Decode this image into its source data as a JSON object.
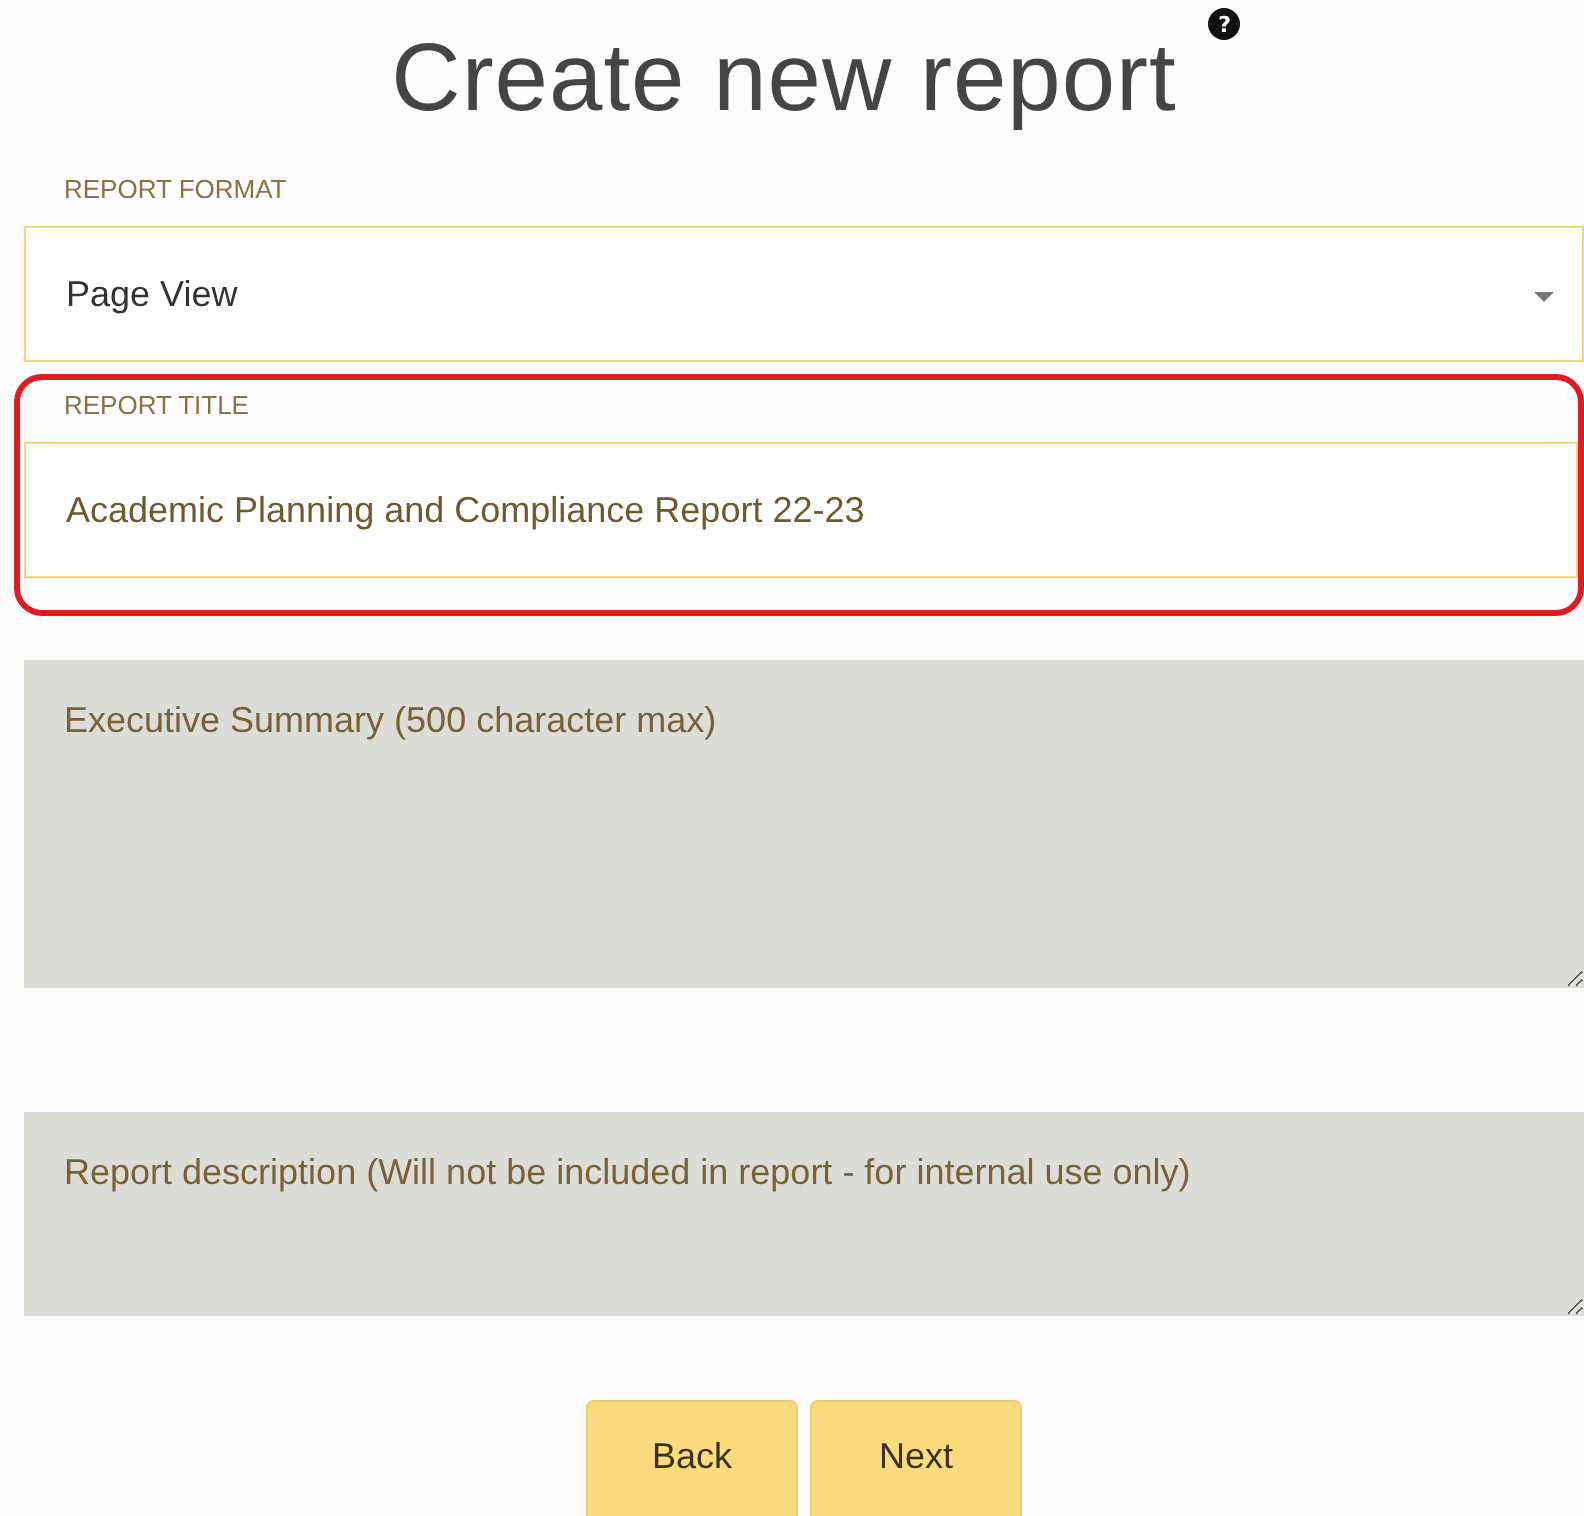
{
  "page": {
    "title": "Create new report",
    "help_badge": "?"
  },
  "report_format": {
    "label": "REPORT FORMAT",
    "value": "Page View"
  },
  "report_title": {
    "label": "REPORT TITLE",
    "value": "Academic Planning and Compliance Report 22-23",
    "highlighted": true
  },
  "executive_summary": {
    "placeholder": "Executive Summary (500 character max)"
  },
  "report_description": {
    "placeholder": "Report description (Will not be included in report - for internal use only)"
  },
  "buttons": [
    {
      "label": "Back"
    },
    {
      "label": "Next"
    }
  ]
}
